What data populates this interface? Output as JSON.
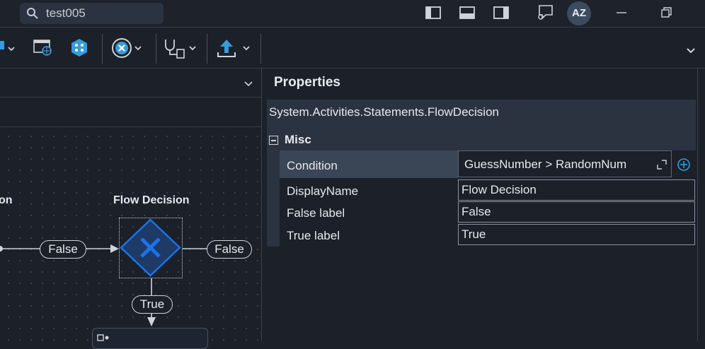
{
  "titlebar": {
    "search": {
      "value": "test005",
      "icon": "search-icon"
    },
    "avatar_initials": "AZ",
    "icons": [
      "layout-left-panel-icon",
      "layout-bottom-panel-icon",
      "layout-right-panel-icon",
      "feedback-icon",
      "minimize-icon",
      "restore-icon"
    ]
  },
  "toolbar": {
    "icons": [
      "dropdown-partial-icon",
      "web-page-icon",
      "orchestrator-hexagon-icon",
      "stop-debug-icon",
      "analyze-file-icon",
      "publish-icon",
      "toolbar-overflow-icon"
    ]
  },
  "designer": {
    "left_node_partial": "on",
    "node_title": "Flow Decision",
    "left_connector_label": "False",
    "right_connector_label": "False",
    "bottom_connector_label": "True"
  },
  "properties": {
    "title": "Properties",
    "type_name": "System.Activities.Statements.FlowDecision",
    "category": "Misc",
    "rows": [
      {
        "name": "Condition",
        "value": "GuessNumber > RandomNum"
      },
      {
        "name": "DisplayName",
        "value": "Flow Decision"
      },
      {
        "name": "False label",
        "value": "False"
      },
      {
        "name": "True label",
        "value": "True"
      }
    ]
  },
  "colors": {
    "background": "#1b2029",
    "panel": "#2c3340",
    "accent_blue": "#1a73e8",
    "decision_fill": "#1e3a66"
  }
}
